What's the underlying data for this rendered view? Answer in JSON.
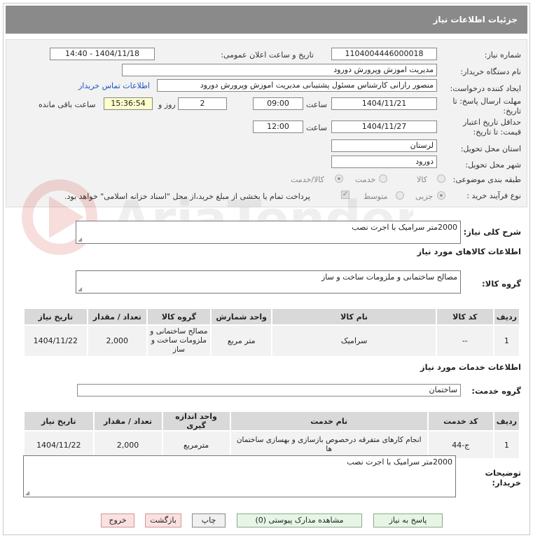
{
  "header": {
    "title": "جزئیات اطلاعات نیاز"
  },
  "form": {
    "need_number_label": "شماره نیاز:",
    "need_number": "1104004446000018",
    "announce_label": "تاریخ و ساعت اعلان عمومی:",
    "announce_value": "1404/11/18 - 14:40",
    "buyer_org_label": "نام دستگاه خریدار:",
    "buyer_org": "مدیریت اموزش وپرورش دورود",
    "creator_label": "ایجاد کننده درخواست:",
    "creator": "منصور رازانی کارشناس مسئول پشتیبانی مدیریت اموزش وپرورش دورود",
    "contact_link": "اطلاعات تماس خریدار",
    "deadline_label_1": "مهلت ارسال پاسخ: تا",
    "deadline_label_2": "تاریخ:",
    "deadline_date": "1404/11/21",
    "time_label": "ساعت",
    "deadline_time": "09:00",
    "days_value": "2",
    "days_label": "روز و",
    "remaining_time": "15:36:54",
    "remaining_label": "ساعت باقی مانده",
    "validity_label_1": "حداقل تاریخ اعتبار",
    "validity_label_2": "قیمت: تا تاریخ:",
    "validity_date": "1404/11/27",
    "validity_time_label": "ساعت",
    "validity_time": "12:00",
    "province_label": "استان محل تحویل:",
    "province": "لرستان",
    "city_label": "شهر محل تحویل:",
    "city": "دورود",
    "category_label": "طبقه بندی موضوعی:",
    "category_options": [
      "کالا",
      "خدمت",
      "کالا/خدمت"
    ],
    "process_label": "نوع فرآیند خرید :",
    "process_options": [
      "جزیی",
      "متوسط"
    ],
    "payment_note": "پرداخت تمام یا بخشی از مبلغ خرید،از محل \"اسناد خزانه اسلامی\" خواهد بود."
  },
  "description": {
    "label": "شرح کلی نیاز:",
    "value": "2000متر سرامیک با اجرت نصب"
  },
  "goods": {
    "section_title": "اطلاعات کالاهای مورد نیاز",
    "group_label": "گروه کالا:",
    "group_value": "مصالح ساختمانی و ملزومات ساخت و ساز",
    "columns": [
      "ردیف",
      "کد کالا",
      "نام کالا",
      "واحد شمارش",
      "گروه کالا",
      "تعداد / مقدار",
      "تاریخ نیاز"
    ],
    "rows": [
      [
        "1",
        "--",
        "سرامیک",
        "متر مربع",
        "مصالح ساختمانی و ملزومات ساخت و ساز",
        "2,000",
        "1404/11/22"
      ]
    ]
  },
  "services": {
    "section_title": "اطلاعات خدمات مورد نیاز",
    "group_label": "گروه خدمت:",
    "group_value": "ساختمان",
    "columns": [
      "ردیف",
      "کد خدمت",
      "نام خدمت",
      "واحد اندازه گیری",
      "تعداد / مقدار",
      "تاریخ نیاز"
    ],
    "rows": [
      [
        "1",
        "ج-44",
        "انجام کارهای متفرقه درخصوص بازسازی و بهسازی ساختمان ها",
        "مترمربع",
        "2,000",
        "1404/11/22"
      ]
    ]
  },
  "buyer_notes": {
    "label_1": "توضیحات",
    "label_2": "خریدار:",
    "value": "2000متر سرامیک با اجرت نصب"
  },
  "buttons": {
    "reply": "پاسخ به نیاز",
    "view_docs": "مشاهده مدارک پیوستی (0)",
    "print": "چاپ",
    "back": "بازگشت",
    "exit": "خروج"
  },
  "watermark": {
    "text": "AriaTender.neT"
  },
  "colors": {
    "titlebar": "#8a8a8a",
    "panel": "#f2f2f2",
    "link": "#1a56c8",
    "remaining_bg": "#ffffcc"
  }
}
